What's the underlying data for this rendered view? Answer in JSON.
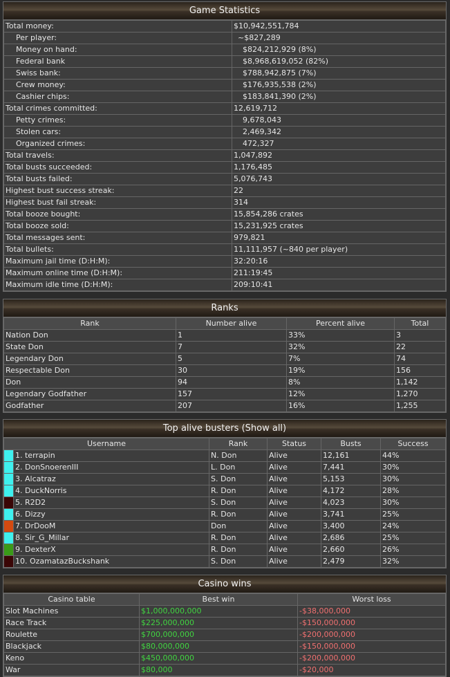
{
  "game_stats": {
    "title": "Game Statistics",
    "rows": [
      {
        "label": "Total money:",
        "value": "$10,942,551,784",
        "indent": false
      },
      {
        "label": "Per player:",
        "value": "~$827,289",
        "indent": true,
        "val_indent": "small"
      },
      {
        "label": "Money on hand:",
        "value": "$824,212,929 (8%)",
        "indent": true,
        "val_indent": "big"
      },
      {
        "label": "Federal bank",
        "value": "$8,968,619,052 (82%)",
        "indent": true,
        "val_indent": "big"
      },
      {
        "label": "Swiss bank:",
        "value": "$788,942,875 (7%)",
        "indent": true,
        "val_indent": "big"
      },
      {
        "label": "Crew money:",
        "value": "$176,935,538 (2%)",
        "indent": true,
        "val_indent": "big"
      },
      {
        "label": "Cashier chips:",
        "value": "$183,841,390 (2%)",
        "indent": true,
        "val_indent": "big"
      },
      {
        "label": "Total crimes committed:",
        "value": "12,619,712",
        "indent": false
      },
      {
        "label": "Petty crimes:",
        "value": "9,678,043",
        "indent": true,
        "val_indent": "big"
      },
      {
        "label": "Stolen cars:",
        "value": "2,469,342",
        "indent": true,
        "val_indent": "big"
      },
      {
        "label": "Organized crimes:",
        "value": "472,327",
        "indent": true,
        "val_indent": "big"
      },
      {
        "label": "Total travels:",
        "value": "1,047,892",
        "indent": false
      },
      {
        "label": "Total busts succeeded:",
        "value": "1,176,485",
        "indent": false
      },
      {
        "label": "Total busts failed:",
        "value": "5,076,743",
        "indent": false
      },
      {
        "label": "Highest bust success streak:",
        "value": "22",
        "indent": false
      },
      {
        "label": "Highest bust fail streak:",
        "value": "314",
        "indent": false
      },
      {
        "label": "Total booze bought:",
        "value": "15,854,286 crates",
        "indent": false
      },
      {
        "label": "Total booze sold:",
        "value": "15,231,925 crates",
        "indent": false
      },
      {
        "label": "Total messages sent:",
        "value": "979,821",
        "indent": false
      },
      {
        "label": "Total bullets:",
        "value": "11,111,957 (~840 per player)",
        "indent": false
      },
      {
        "label": "Maximum jail time (D:H:M):",
        "value": "32:20:16",
        "indent": false
      },
      {
        "label": "Maximum online time (D:H:M):",
        "value": "211:19:45",
        "indent": false
      },
      {
        "label": "Maximum idle time (D:H:M):",
        "value": "209:10:41",
        "indent": false
      }
    ]
  },
  "ranks": {
    "title": "Ranks",
    "headers": [
      "Rank",
      "Number alive",
      "Percent alive",
      "Total"
    ],
    "rows": [
      [
        "Nation Don",
        "1",
        "33%",
        "3"
      ],
      [
        "State Don",
        "7",
        "32%",
        "22"
      ],
      [
        "Legendary Don",
        "5",
        "7%",
        "74"
      ],
      [
        "Respectable Don",
        "30",
        "19%",
        "156"
      ],
      [
        "Don",
        "94",
        "8%",
        "1,142"
      ],
      [
        "Legendary Godfather",
        "157",
        "12%",
        "1,270"
      ],
      [
        "Godfather",
        "207",
        "16%",
        "1,255"
      ]
    ]
  },
  "busters": {
    "title": "Top alive busters (Show all)",
    "headers": [
      "Username",
      "Rank",
      "Status",
      "Busts",
      "Success"
    ],
    "rows": [
      {
        "color": "#3ff0ee",
        "name": "1. terrapin",
        "rank": "N. Don",
        "status": "Alive",
        "busts": "12,161",
        "success": "44%"
      },
      {
        "color": "#3ff0ee",
        "name": "2. DonSnoerenIII",
        "rank": "L. Don",
        "status": "Alive",
        "busts": "7,441",
        "success": "30%"
      },
      {
        "color": "#3ff0ee",
        "name": "3. Alcatraz",
        "rank": "S. Don",
        "status": "Alive",
        "busts": "5,153",
        "success": "30%"
      },
      {
        "color": "#3ff0ee",
        "name": "4. DuckNorris",
        "rank": "R. Don",
        "status": "Alive",
        "busts": "4,172",
        "success": "28%"
      },
      {
        "color": "#3a0606",
        "name": "5. R2D2",
        "rank": "S. Don",
        "status": "Alive",
        "busts": "4,023",
        "success": "30%"
      },
      {
        "color": "#3ff0ee",
        "name": "6. Dizzy",
        "rank": "R. Don",
        "status": "Alive",
        "busts": "3,741",
        "success": "25%"
      },
      {
        "color": "#d54a10",
        "name": "7. DrDooM",
        "rank": "Don",
        "status": "Alive",
        "busts": "3,400",
        "success": "24%"
      },
      {
        "color": "#3ff0ee",
        "name": "8. Sir_G_Millar",
        "rank": "R. Don",
        "status": "Alive",
        "busts": "2,686",
        "success": "25%"
      },
      {
        "color": "#3a9a18",
        "name": "9. DexterX",
        "rank": "R. Don",
        "status": "Alive",
        "busts": "2,660",
        "success": "26%"
      },
      {
        "color": "#3a0606",
        "name": "10. OzamatazBuckshank",
        "rank": "S. Don",
        "status": "Alive",
        "busts": "2,479",
        "success": "32%"
      }
    ]
  },
  "casino": {
    "title": "Casino wins",
    "headers": [
      "Casino table",
      "Best win",
      "Worst loss"
    ],
    "rows": [
      [
        "Slot Machines",
        "$1,000,000,000",
        "-$38,000,000"
      ],
      [
        "Race Track",
        "$225,000,000",
        "-$150,000,000"
      ],
      [
        "Roulette",
        "$700,000,000",
        "-$200,000,000"
      ],
      [
        "Blackjack",
        "$80,000,000",
        "-$150,000,000"
      ],
      [
        "Keno",
        "$450,000,000",
        "-$200,000,000"
      ],
      [
        "War",
        "$80,000",
        "-$20,000"
      ]
    ],
    "colors": {
      "win": "#41d441",
      "loss": "#f07070"
    }
  }
}
